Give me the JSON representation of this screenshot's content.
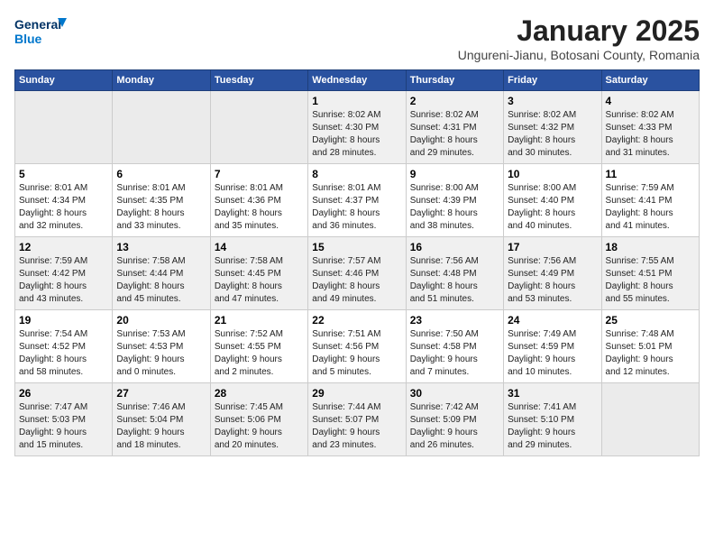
{
  "logo": {
    "general": "General",
    "blue": "Blue"
  },
  "header": {
    "title": "January 2025",
    "subtitle": "Ungureni-Jianu, Botosani County, Romania"
  },
  "weekdays": [
    "Sunday",
    "Monday",
    "Tuesday",
    "Wednesday",
    "Thursday",
    "Friday",
    "Saturday"
  ],
  "weeks": [
    [
      {
        "day": "",
        "info": ""
      },
      {
        "day": "",
        "info": ""
      },
      {
        "day": "",
        "info": ""
      },
      {
        "day": "1",
        "info": "Sunrise: 8:02 AM\nSunset: 4:30 PM\nDaylight: 8 hours\nand 28 minutes."
      },
      {
        "day": "2",
        "info": "Sunrise: 8:02 AM\nSunset: 4:31 PM\nDaylight: 8 hours\nand 29 minutes."
      },
      {
        "day": "3",
        "info": "Sunrise: 8:02 AM\nSunset: 4:32 PM\nDaylight: 8 hours\nand 30 minutes."
      },
      {
        "day": "4",
        "info": "Sunrise: 8:02 AM\nSunset: 4:33 PM\nDaylight: 8 hours\nand 31 minutes."
      }
    ],
    [
      {
        "day": "5",
        "info": "Sunrise: 8:01 AM\nSunset: 4:34 PM\nDaylight: 8 hours\nand 32 minutes."
      },
      {
        "day": "6",
        "info": "Sunrise: 8:01 AM\nSunset: 4:35 PM\nDaylight: 8 hours\nand 33 minutes."
      },
      {
        "day": "7",
        "info": "Sunrise: 8:01 AM\nSunset: 4:36 PM\nDaylight: 8 hours\nand 35 minutes."
      },
      {
        "day": "8",
        "info": "Sunrise: 8:01 AM\nSunset: 4:37 PM\nDaylight: 8 hours\nand 36 minutes."
      },
      {
        "day": "9",
        "info": "Sunrise: 8:00 AM\nSunset: 4:39 PM\nDaylight: 8 hours\nand 38 minutes."
      },
      {
        "day": "10",
        "info": "Sunrise: 8:00 AM\nSunset: 4:40 PM\nDaylight: 8 hours\nand 40 minutes."
      },
      {
        "day": "11",
        "info": "Sunrise: 7:59 AM\nSunset: 4:41 PM\nDaylight: 8 hours\nand 41 minutes."
      }
    ],
    [
      {
        "day": "12",
        "info": "Sunrise: 7:59 AM\nSunset: 4:42 PM\nDaylight: 8 hours\nand 43 minutes."
      },
      {
        "day": "13",
        "info": "Sunrise: 7:58 AM\nSunset: 4:44 PM\nDaylight: 8 hours\nand 45 minutes."
      },
      {
        "day": "14",
        "info": "Sunrise: 7:58 AM\nSunset: 4:45 PM\nDaylight: 8 hours\nand 47 minutes."
      },
      {
        "day": "15",
        "info": "Sunrise: 7:57 AM\nSunset: 4:46 PM\nDaylight: 8 hours\nand 49 minutes."
      },
      {
        "day": "16",
        "info": "Sunrise: 7:56 AM\nSunset: 4:48 PM\nDaylight: 8 hours\nand 51 minutes."
      },
      {
        "day": "17",
        "info": "Sunrise: 7:56 AM\nSunset: 4:49 PM\nDaylight: 8 hours\nand 53 minutes."
      },
      {
        "day": "18",
        "info": "Sunrise: 7:55 AM\nSunset: 4:51 PM\nDaylight: 8 hours\nand 55 minutes."
      }
    ],
    [
      {
        "day": "19",
        "info": "Sunrise: 7:54 AM\nSunset: 4:52 PM\nDaylight: 8 hours\nand 58 minutes."
      },
      {
        "day": "20",
        "info": "Sunrise: 7:53 AM\nSunset: 4:53 PM\nDaylight: 9 hours\nand 0 minutes."
      },
      {
        "day": "21",
        "info": "Sunrise: 7:52 AM\nSunset: 4:55 PM\nDaylight: 9 hours\nand 2 minutes."
      },
      {
        "day": "22",
        "info": "Sunrise: 7:51 AM\nSunset: 4:56 PM\nDaylight: 9 hours\nand 5 minutes."
      },
      {
        "day": "23",
        "info": "Sunrise: 7:50 AM\nSunset: 4:58 PM\nDaylight: 9 hours\nand 7 minutes."
      },
      {
        "day": "24",
        "info": "Sunrise: 7:49 AM\nSunset: 4:59 PM\nDaylight: 9 hours\nand 10 minutes."
      },
      {
        "day": "25",
        "info": "Sunrise: 7:48 AM\nSunset: 5:01 PM\nDaylight: 9 hours\nand 12 minutes."
      }
    ],
    [
      {
        "day": "26",
        "info": "Sunrise: 7:47 AM\nSunset: 5:03 PM\nDaylight: 9 hours\nand 15 minutes."
      },
      {
        "day": "27",
        "info": "Sunrise: 7:46 AM\nSunset: 5:04 PM\nDaylight: 9 hours\nand 18 minutes."
      },
      {
        "day": "28",
        "info": "Sunrise: 7:45 AM\nSunset: 5:06 PM\nDaylight: 9 hours\nand 20 minutes."
      },
      {
        "day": "29",
        "info": "Sunrise: 7:44 AM\nSunset: 5:07 PM\nDaylight: 9 hours\nand 23 minutes."
      },
      {
        "day": "30",
        "info": "Sunrise: 7:42 AM\nSunset: 5:09 PM\nDaylight: 9 hours\nand 26 minutes."
      },
      {
        "day": "31",
        "info": "Sunrise: 7:41 AM\nSunset: 5:10 PM\nDaylight: 9 hours\nand 29 minutes."
      },
      {
        "day": "",
        "info": ""
      }
    ]
  ]
}
